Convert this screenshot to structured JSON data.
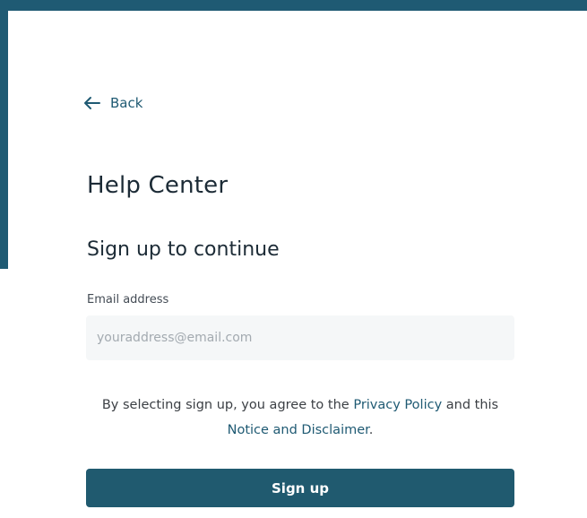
{
  "nav": {
    "back_label": "Back",
    "back_icon": "arrow-left-icon"
  },
  "header": {
    "title": "Help Center"
  },
  "form": {
    "subtitle": "Sign up to continue",
    "email_label": "Email address",
    "email_placeholder": "youraddress@email.com",
    "email_value": "",
    "agreement_prefix": "By selecting sign up, you agree to the ",
    "privacy_link": "Privacy Policy",
    "agreement_mid": " and this ",
    "notice_link": "Notice and Disclaimer",
    "agreement_suffix": ".",
    "submit_label": "Sign up"
  },
  "colors": {
    "brand": "#1f5a73",
    "button": "#205a6f",
    "input_bg": "#f5f7f8",
    "text": "#1c2b36"
  }
}
